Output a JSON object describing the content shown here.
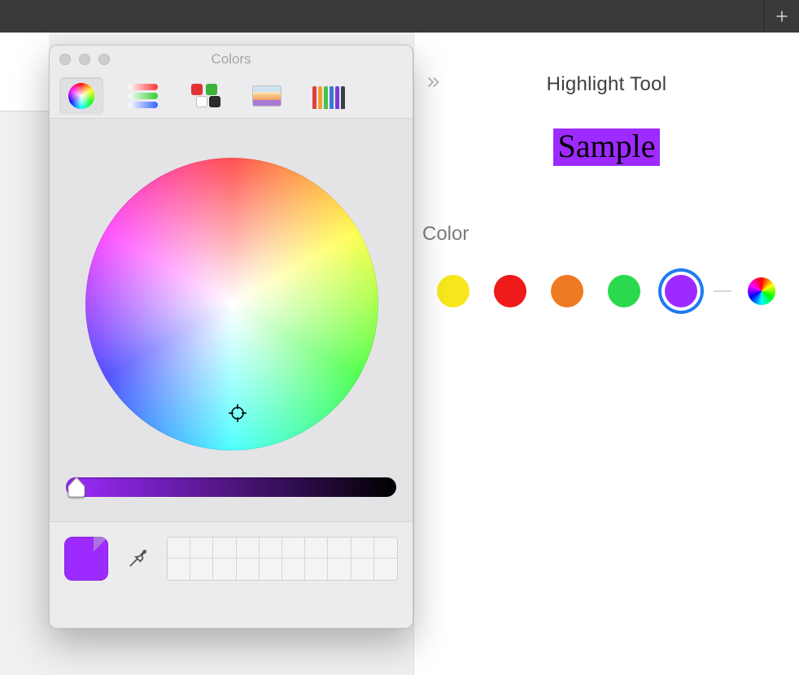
{
  "colors": {
    "highlight": "#9d2bff",
    "accent_blue": "#1f7cf1"
  },
  "tab_bar": {
    "new_tab_label": "New Tab"
  },
  "inspector": {
    "title": "Highlight Tool",
    "sample_text": "Sample",
    "color_section_label": "Color",
    "swatches": [
      {
        "name": "yellow",
        "hex": "#f8e71c",
        "selected": false
      },
      {
        "name": "red",
        "hex": "#ef1a1a",
        "selected": false
      },
      {
        "name": "orange",
        "hex": "#f07a23",
        "selected": false
      },
      {
        "name": "green",
        "hex": "#2bd94e",
        "selected": false
      },
      {
        "name": "purple",
        "hex": "#9d2bff",
        "selected": true
      }
    ]
  },
  "color_panel": {
    "window_title": "Colors",
    "active_tab": "wheel",
    "tabs": [
      "wheel",
      "sliders",
      "palettes",
      "image",
      "pencils"
    ],
    "brightness": 1.0,
    "current_color": "#9d2bff",
    "saved_swatches_rows": 2,
    "saved_swatches_cols": 10
  }
}
